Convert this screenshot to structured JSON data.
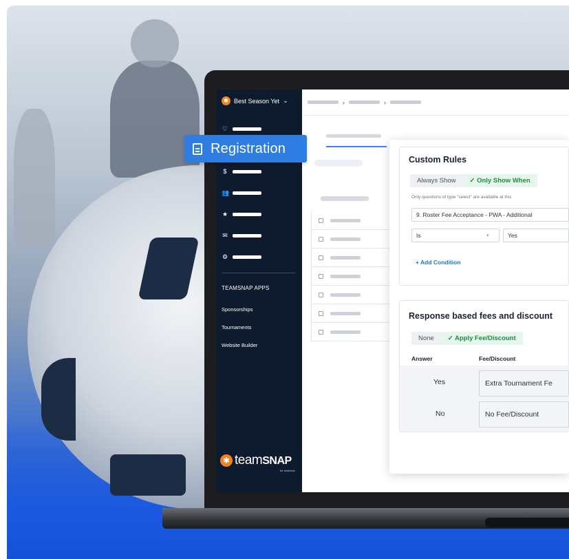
{
  "sidebar": {
    "org_name": "Best Season Yet",
    "org_chevron": "⌄",
    "nav_icons": [
      "♡",
      "$",
      "👥",
      "★",
      "✉",
      "⚙"
    ],
    "apps_heading": "TEAMSNAP APPS",
    "apps": [
      "Sponsorships",
      "Tournaments",
      "Website Builder"
    ],
    "logo_prefix": "team",
    "logo_bold": "SNAP",
    "logo_sub": "for business"
  },
  "highlight": {
    "label": "Registration"
  },
  "custom_rules": {
    "title": "Custom Rules",
    "tabs": [
      {
        "label": "Always Show",
        "active": false
      },
      {
        "label": "✓ Only Show When",
        "active": true
      }
    ],
    "hint": "Only questions of type \"select\" are available at this",
    "question": "9. Roster Fee Acceptance - PWA - Additional",
    "operator": "Is",
    "value": "Yes",
    "add_condition": "+ Add Condition"
  },
  "fees": {
    "title": "Response based fees and discount",
    "tabs": [
      {
        "label": "None",
        "active": false
      },
      {
        "label": "✓ Apply Fee/Discount",
        "active": true
      }
    ],
    "col_answer": "Answer",
    "col_fee": "Fee/Discount",
    "rows": [
      {
        "answer": "Yes",
        "fee": "Extra Tournament Fe"
      },
      {
        "answer": "No",
        "fee": "No Fee/Discount"
      }
    ]
  },
  "colors": {
    "accent": "#2f7de1",
    "sidebar": "#0e1b2e",
    "brand_orange": "#f58220",
    "active_green": "#1a8d3e"
  }
}
